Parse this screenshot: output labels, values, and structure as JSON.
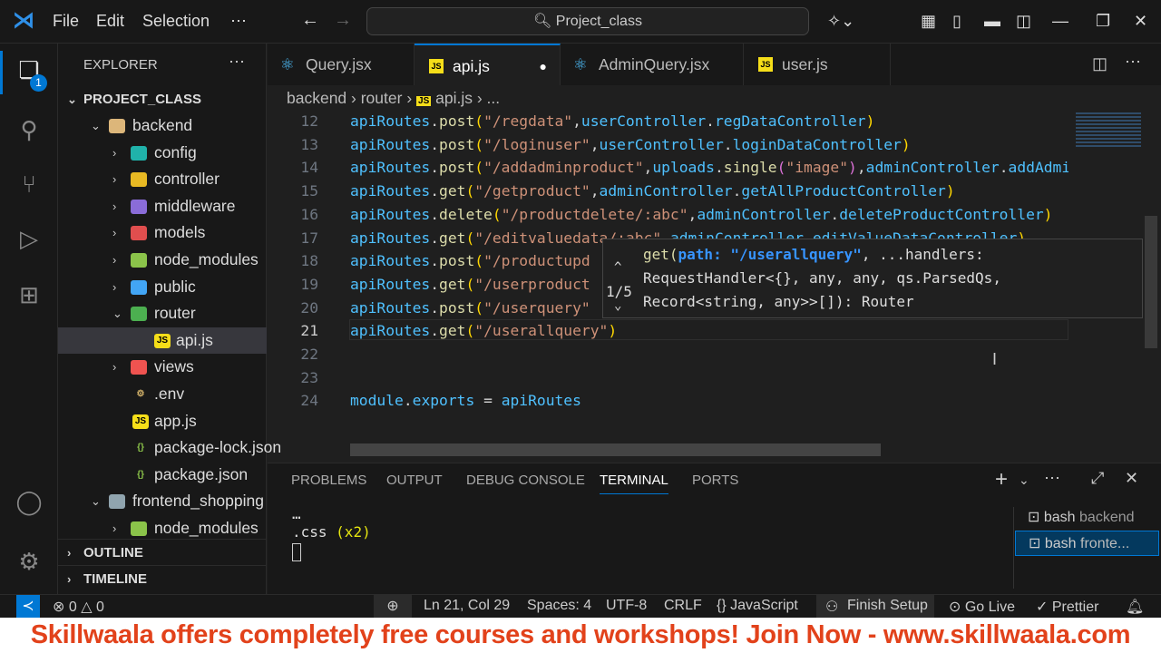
{
  "titlebar": {
    "menu": [
      "File",
      "Edit",
      "Selection",
      "⋯"
    ],
    "search": "Project_class"
  },
  "activity": {
    "explorer_badge": "1"
  },
  "sidebar": {
    "title": "EXPLORER",
    "root": "PROJECT_CLASS",
    "items": [
      {
        "label": "backend",
        "depth": 1,
        "type": "folder",
        "open": true,
        "color": "#dcb67a"
      },
      {
        "label": "config",
        "depth": 2,
        "type": "folder",
        "color": "#20b2aa"
      },
      {
        "label": "controller",
        "depth": 2,
        "type": "folder",
        "color": "#e8b923"
      },
      {
        "label": "middleware",
        "depth": 2,
        "type": "folder",
        "color": "#8a6cd8"
      },
      {
        "label": "models",
        "depth": 2,
        "type": "folder",
        "color": "#e04e4e"
      },
      {
        "label": "node_modules",
        "depth": 2,
        "type": "folder",
        "color": "#8bc34a"
      },
      {
        "label": "public",
        "depth": 2,
        "type": "folder",
        "color": "#42a5f5"
      },
      {
        "label": "router",
        "depth": 2,
        "type": "folder",
        "open": true,
        "color": "#4caf50"
      },
      {
        "label": "api.js",
        "depth": 3,
        "type": "js",
        "selected": true,
        "color": "#f5de19"
      },
      {
        "label": "views",
        "depth": 2,
        "type": "folder",
        "color": "#ef5350"
      },
      {
        "label": ".env",
        "depth": 2,
        "type": "env",
        "color": "#d4b36a"
      },
      {
        "label": "app.js",
        "depth": 2,
        "type": "js",
        "color": "#f5de19"
      },
      {
        "label": "package-lock.json",
        "depth": 2,
        "type": "node",
        "color": "#8bc34a"
      },
      {
        "label": "package.json",
        "depth": 2,
        "type": "node",
        "color": "#8bc34a"
      },
      {
        "label": "frontend_shopping",
        "depth": 1,
        "type": "folder",
        "open": true,
        "color": "#90a4ae"
      },
      {
        "label": "node_modules",
        "depth": 2,
        "type": "folder",
        "color": "#8bc34a"
      }
    ],
    "outline": "OUTLINE",
    "timeline": "TIMELINE"
  },
  "tabs": [
    {
      "label": "Query.jsx",
      "icon": "react"
    },
    {
      "label": "api.js",
      "icon": "js",
      "active": true,
      "dirty": true
    },
    {
      "label": "AdminQuery.jsx",
      "icon": "react"
    },
    {
      "label": "user.js",
      "icon": "js"
    }
  ],
  "breadcrumb": [
    "backend",
    "router",
    "api.js",
    "..."
  ],
  "code": [
    {
      "n": "12",
      "t": [
        [
          "v",
          "apiRoutes"
        ],
        [
          "w",
          "."
        ],
        [
          "f",
          "post"
        ],
        [
          "p",
          "("
        ],
        [
          "s",
          "\"/regdata\""
        ],
        [
          "w",
          ","
        ],
        [
          "v",
          "userController"
        ],
        [
          "w",
          "."
        ],
        [
          "v",
          "regDataController"
        ],
        [
          "p",
          ")"
        ]
      ]
    },
    {
      "n": "13",
      "t": [
        [
          "v",
          "apiRoutes"
        ],
        [
          "w",
          "."
        ],
        [
          "f",
          "post"
        ],
        [
          "p",
          "("
        ],
        [
          "s",
          "\"/loginuser\""
        ],
        [
          "w",
          ","
        ],
        [
          "v",
          "userController"
        ],
        [
          "w",
          "."
        ],
        [
          "v",
          "loginDataController"
        ],
        [
          "p",
          ")"
        ]
      ]
    },
    {
      "n": "14",
      "t": [
        [
          "v",
          "apiRoutes"
        ],
        [
          "w",
          "."
        ],
        [
          "f",
          "post"
        ],
        [
          "p",
          "("
        ],
        [
          "s",
          "\"/addadminproduct\""
        ],
        [
          "w",
          ","
        ],
        [
          "v",
          "uploads"
        ],
        [
          "w",
          "."
        ],
        [
          "f",
          "single"
        ],
        [
          "pp",
          "("
        ],
        [
          "s",
          "\"image\""
        ],
        [
          "pp",
          ")"
        ],
        [
          "w",
          ","
        ],
        [
          "v",
          "adminController"
        ],
        [
          "w",
          "."
        ],
        [
          "v",
          "addAdminProductController"
        ],
        [
          "p",
          ")"
        ]
      ]
    },
    {
      "n": "15",
      "t": [
        [
          "v",
          "apiRoutes"
        ],
        [
          "w",
          "."
        ],
        [
          "f",
          "get"
        ],
        [
          "p",
          "("
        ],
        [
          "s",
          "\"/getproduct\""
        ],
        [
          "w",
          ","
        ],
        [
          "v",
          "adminController"
        ],
        [
          "w",
          "."
        ],
        [
          "v",
          "getAllProductController"
        ],
        [
          "p",
          ")"
        ]
      ]
    },
    {
      "n": "16",
      "t": [
        [
          "v",
          "apiRoutes"
        ],
        [
          "w",
          "."
        ],
        [
          "f",
          "delete"
        ],
        [
          "p",
          "("
        ],
        [
          "s",
          "\"/productdelete/:abc\""
        ],
        [
          "w",
          ","
        ],
        [
          "v",
          "adminController"
        ],
        [
          "w",
          "."
        ],
        [
          "v",
          "deleteProductController"
        ],
        [
          "p",
          ")"
        ]
      ]
    },
    {
      "n": "17",
      "t": [
        [
          "v",
          "apiRoutes"
        ],
        [
          "w",
          "."
        ],
        [
          "f",
          "get"
        ],
        [
          "p",
          "("
        ],
        [
          "s",
          "\"/editvaluedata/:abc\""
        ],
        [
          "w",
          ","
        ],
        [
          "v",
          "adminController"
        ],
        [
          "w",
          "."
        ],
        [
          "v",
          "editValueDataController"
        ],
        [
          "p",
          ")"
        ]
      ]
    },
    {
      "n": "18",
      "t": [
        [
          "v",
          "apiRoutes"
        ],
        [
          "w",
          "."
        ],
        [
          "f",
          "post"
        ],
        [
          "p",
          "("
        ],
        [
          "s",
          "\"/productupd"
        ]
      ]
    },
    {
      "n": "19",
      "t": [
        [
          "v",
          "apiRoutes"
        ],
        [
          "w",
          "."
        ],
        [
          "f",
          "get"
        ],
        [
          "p",
          "("
        ],
        [
          "s",
          "\"/userproduct"
        ]
      ]
    },
    {
      "n": "20",
      "t": [
        [
          "v",
          "apiRoutes"
        ],
        [
          "w",
          "."
        ],
        [
          "f",
          "post"
        ],
        [
          "p",
          "("
        ],
        [
          "s",
          "\"/userquery\""
        ]
      ]
    },
    {
      "n": "21",
      "t": [
        [
          "v",
          "apiRoutes"
        ],
        [
          "w",
          "."
        ],
        [
          "f",
          "get"
        ],
        [
          "p",
          "("
        ],
        [
          "s",
          "\"/userallquery\""
        ],
        [
          "p",
          ")"
        ]
      ]
    },
    {
      "n": "22",
      "t": []
    },
    {
      "n": "23",
      "t": []
    },
    {
      "n": "24",
      "t": [
        [
          "v",
          "module"
        ],
        [
          "w",
          "."
        ],
        [
          "v",
          "exports"
        ],
        [
          "w",
          " = "
        ],
        [
          "v",
          "apiRoutes"
        ]
      ]
    }
  ],
  "tooltip": {
    "counter": "1/5",
    "line1_a": "get(",
    "line1_b": "path: ",
    "line1_c": "\"/userallquery\"",
    "line1_d": ", ...handlers:",
    "line2": "RequestHandler<{}, any, any, qs.ParsedQs,",
    "line3": "Record<string, any>>[]): Router"
  },
  "panel": {
    "tabs": [
      "PROBLEMS",
      "OUTPUT",
      "DEBUG CONSOLE",
      "TERMINAL",
      "PORTS"
    ],
    "active": "TERMINAL",
    "term_lines": [
      "…",
      ".css",
      "(x2)"
    ],
    "terminals": [
      {
        "name": "bash",
        "label": "backend"
      },
      {
        "name": "bash",
        "label": "fronte..."
      }
    ]
  },
  "status": {
    "errors": "0",
    "warnings": "0",
    "position": "Ln 21, Col 29",
    "spaces": "Spaces: 4",
    "encoding": "UTF-8",
    "eol": "CRLF",
    "language": "JavaScript",
    "finish": "Finish Setup",
    "golive": "Go Live",
    "prettier": "Prettier"
  },
  "banner": "Skillwaala offers completely free courses and workshops! Join Now  - www.skillwaala.com"
}
